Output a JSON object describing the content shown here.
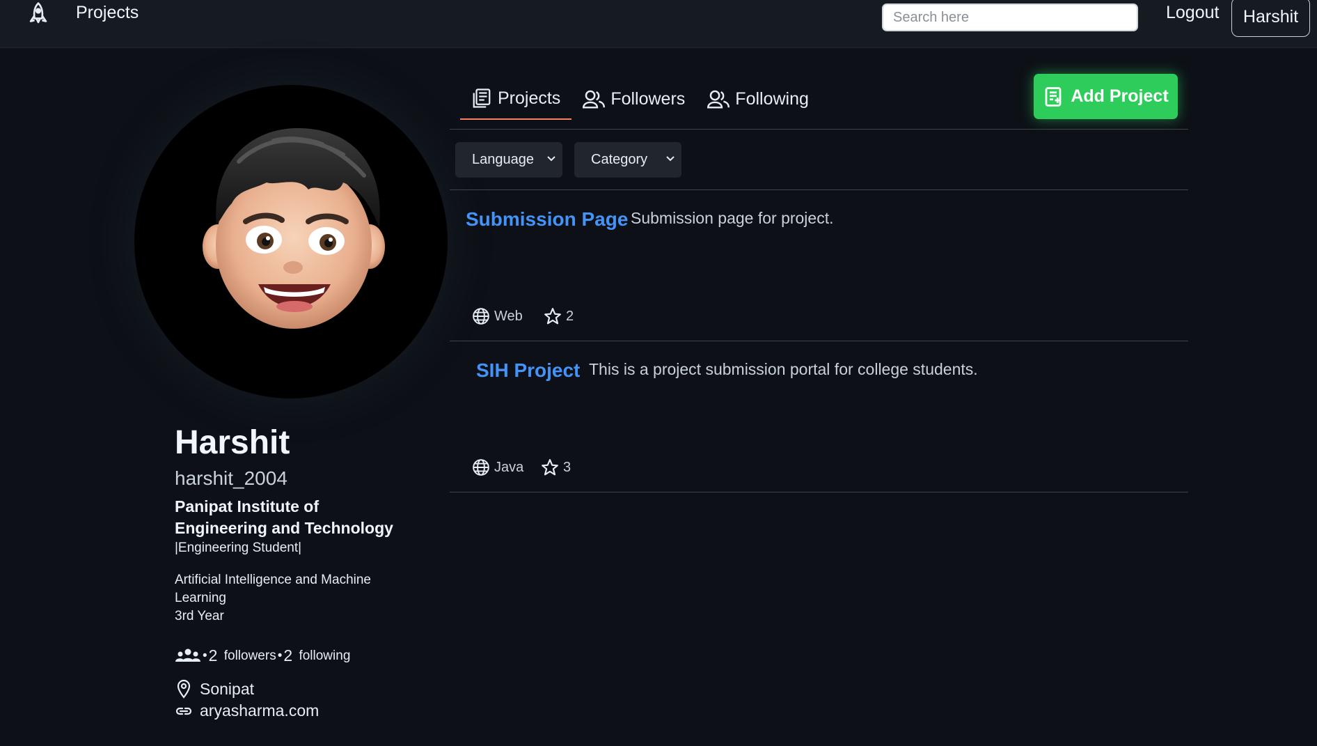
{
  "nav": {
    "brand": "Projects",
    "search_placeholder": "Search here",
    "logout": "Logout",
    "user": "Harshit"
  },
  "profile": {
    "name": "Harshit",
    "username": "harshit_2004",
    "institute": "Panipat Institute of Engineering and Technology",
    "role": "|Engineering Student|",
    "branch": "Artificial Intelligence and Machine Learning",
    "year": "3rd Year",
    "followers_count": "2",
    "followers_label": "followers",
    "following_count": "2",
    "following_label": "following",
    "separator": "•",
    "location": "Sonipat",
    "website": "aryasharma.com"
  },
  "tabs": [
    {
      "label": "Projects",
      "icon": "projects-icon",
      "active": true
    },
    {
      "label": "Followers",
      "icon": "people-icon",
      "active": false
    },
    {
      "label": "Following",
      "icon": "people-icon",
      "active": false
    }
  ],
  "add_project": "Add Project",
  "filters": {
    "language": "Language",
    "category": "Category"
  },
  "projects": [
    {
      "title": "Submission Page",
      "description": "Submission page for project.",
      "category": "Web",
      "stars": "2"
    },
    {
      "title": "SIH Project",
      "description": "This is a project submission portal for college students.",
      "category": "Java",
      "stars": "3"
    }
  ],
  "colors": {
    "background": "#0d1117",
    "topbar": "#161b22",
    "link": "#4493f8",
    "accent_green": "#2ecc5a",
    "active_tab_underline": "#f78166"
  }
}
